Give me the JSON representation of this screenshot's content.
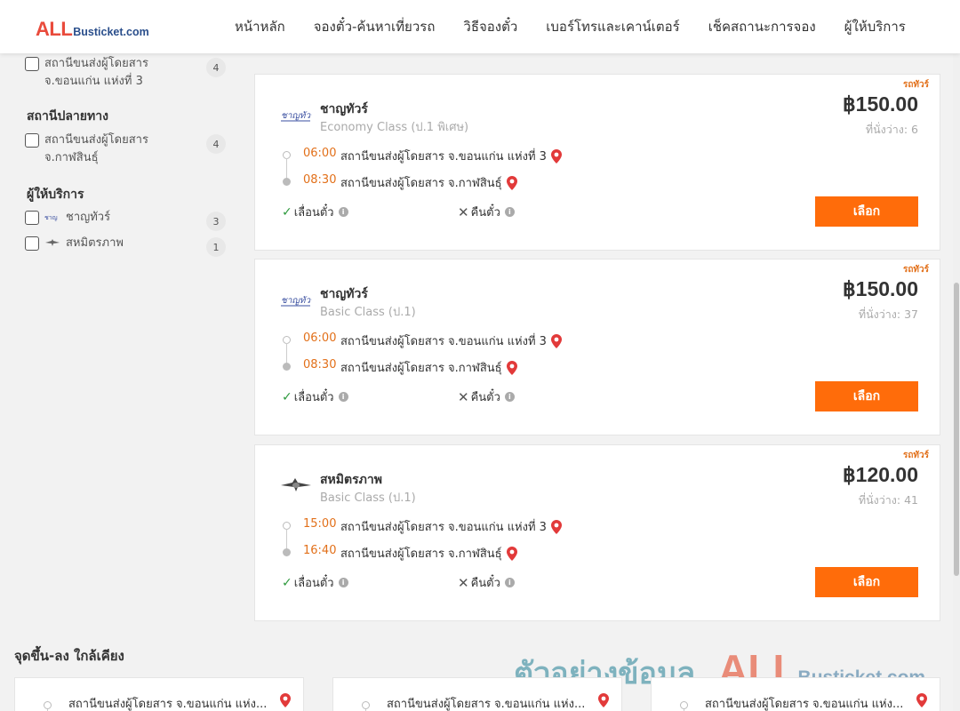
{
  "header": {
    "logo_all": "ALL",
    "logo_rest": "Busticket.com",
    "nav": [
      "หน้าหลัก",
      "จองตั๋ว-ค้นหาเที่ยวรถ",
      "วิธีจองตั๋ว",
      "เบอร์โทรและเคาน์เตอร์",
      "เช็คสถานะการจอง",
      "ผู้ให้บริการ"
    ]
  },
  "sidebar": {
    "origin_item": {
      "label": "สถานีขนส่งผู้โดยสาร จ.ขอนแก่น แห่งที่ 3",
      "count": "4",
      "checked": false
    },
    "destination_heading": "สถานีปลายทาง",
    "destination_item": {
      "label": "สถานีขนส่งผู้โดยสาร จ.กาฬสินธุ์",
      "count": "4",
      "checked": false
    },
    "operator_heading": "ผู้ให้บริการ",
    "operators": [
      {
        "label": "ชาญทัวร์",
        "count": "3",
        "logo": "chantour-logo-icon"
      },
      {
        "label": "สหมิตรภาพ",
        "count": "1",
        "logo": "sahamitraphap-logo-icon"
      }
    ]
  },
  "results": [
    {
      "tag": "รถทัวร์",
      "operator": "ชาญทัวร์",
      "class": "Economy Class (ป.1 พิเศษ)",
      "price": "฿150.00",
      "seats": "ที่นั่งว่าง: 6",
      "depart_time": "06:00",
      "depart_station": "สถานีขนส่งผู้โดยสาร จ.ขอนแก่น แห่งที่ 3",
      "arrive_time": "08:30",
      "arrive_station": "สถานีขนส่งผู้โดยสาร จ.กาฬสินธุ์",
      "reschedule": "เลื่อนตั๋ว",
      "refund": "คืนตั๋ว",
      "select": "เลือก",
      "logo": "chantour-logo-icon"
    },
    {
      "tag": "รถทัวร์",
      "operator": "ชาญทัวร์",
      "class": "Basic Class (ป.1)",
      "price": "฿150.00",
      "seats": "ที่นั่งว่าง: 37",
      "depart_time": "06:00",
      "depart_station": "สถานีขนส่งผู้โดยสาร จ.ขอนแก่น แห่งที่ 3",
      "arrive_time": "08:30",
      "arrive_station": "สถานีขนส่งผู้โดยสาร จ.กาฬสินธุ์",
      "reschedule": "เลื่อนตั๋ว",
      "refund": "คืนตั๋ว",
      "select": "เลือก",
      "logo": "chantour-logo-icon"
    },
    {
      "tag": "รถทัวร์",
      "operator": "สหมิตรภาพ",
      "class": "Basic Class (ป.1)",
      "price": "฿120.00",
      "seats": "ที่นั่งว่าง: 41",
      "depart_time": "15:00",
      "depart_station": "สถานีขนส่งผู้โดยสาร จ.ขอนแก่น แห่งที่ 3",
      "arrive_time": "16:40",
      "arrive_station": "สถานีขนส่งผู้โดยสาร จ.กาฬสินธุ์",
      "reschedule": "เลื่อนตั๋ว",
      "refund": "คืนตั๋ว",
      "select": "เลือก",
      "logo": "sahamitraphap-logo-icon"
    }
  ],
  "nearby": {
    "title": "จุดขึ้น-ลง ใกล้เคียง",
    "items": [
      "สถานีขนส่งผู้โดยสาร จ.ขอนแก่น แห่ง...",
      "สถานีขนส่งผู้โดยสาร จ.ขอนแก่น แห่ง...",
      "สถานีขนส่งผู้โดยสาร จ.ขอนแก่น แห่ง..."
    ]
  },
  "watermark": {
    "text": "ตัวอย่างข้อมูล",
    "all": "ALL",
    "rest": "Busticket.com"
  },
  "colors": {
    "accent": "#ff6c0a",
    "time": "#e2701a",
    "pin": "#e23a3a",
    "ok": "#2e9a3e",
    "logo_red": "#e94b3c",
    "logo_blue": "#2b4f8c"
  }
}
